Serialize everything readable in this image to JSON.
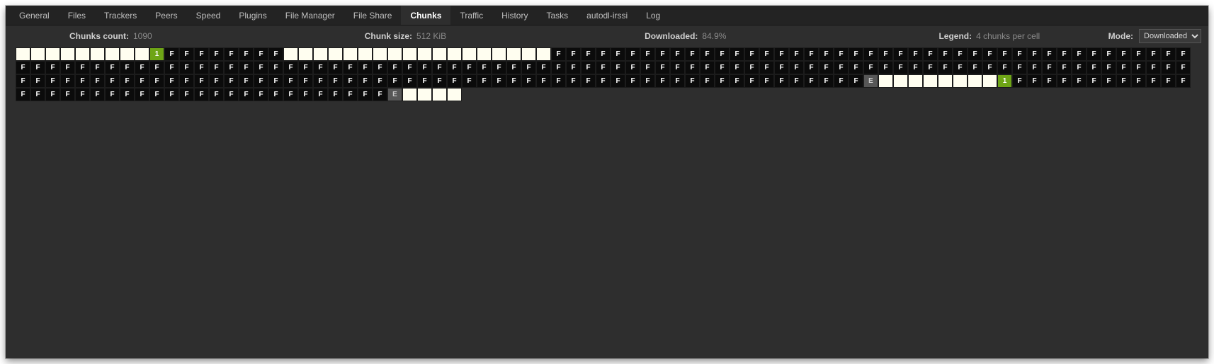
{
  "tabs": [
    {
      "label": "General",
      "active": false
    },
    {
      "label": "Files",
      "active": false
    },
    {
      "label": "Trackers",
      "active": false
    },
    {
      "label": "Peers",
      "active": false
    },
    {
      "label": "Speed",
      "active": false
    },
    {
      "label": "Plugins",
      "active": false
    },
    {
      "label": "File Manager",
      "active": false
    },
    {
      "label": "File Share",
      "active": false
    },
    {
      "label": "Chunks",
      "active": true
    },
    {
      "label": "Traffic",
      "active": false
    },
    {
      "label": "History",
      "active": false
    },
    {
      "label": "Tasks",
      "active": false
    },
    {
      "label": "autodl-irssi",
      "active": false
    },
    {
      "label": "Log",
      "active": false
    }
  ],
  "info": {
    "chunks_count_label": "Chunks count:",
    "chunks_count_value": "1090",
    "chunk_size_label": "Chunk size:",
    "chunk_size_value": "512 KiB",
    "downloaded_label": "Downloaded:",
    "downloaded_value": "84.9%",
    "legend_label": "Legend:",
    "legend_value": "4 chunks per cell",
    "mode_label": "Mode:",
    "mode_value": "Downloaded"
  },
  "grid": {
    "cols": 74,
    "rows": 4,
    "cells": [
      "E",
      "E",
      "E",
      "E",
      "E",
      "E",
      "E",
      "E",
      "E",
      "G",
      "F",
      "F",
      "F",
      "F",
      "F",
      "F",
      "F",
      "F",
      "E",
      "E",
      "E",
      "E",
      "E",
      "E",
      "E",
      "E",
      "E",
      "E",
      "E",
      "E",
      "E",
      "E",
      "E",
      "E",
      "E",
      "E",
      "F",
      "F",
      "F",
      "F",
      "F",
      "F",
      "F",
      "F",
      "F",
      "F",
      "F",
      "F",
      "F",
      "F",
      "F",
      "F",
      "F",
      "F",
      "F",
      "F",
      "F",
      "F",
      "F",
      "F",
      "F",
      "F",
      "F",
      "F",
      "F",
      "F",
      "F",
      "F",
      "F",
      "F",
      "F",
      "F",
      "F",
      "F",
      "F",
      "F",
      "F",
      "F",
      "F",
      "F",
      "F",
      "F",
      "F",
      "F",
      "F",
      "F",
      "F",
      "F",
      "F",
      "F",
      "F",
      "F",
      "F",
      "F",
      "F",
      "F",
      "F",
      "F",
      "F",
      "F",
      "F",
      "F",
      "F",
      "F",
      "F",
      "F",
      "F",
      "F",
      "F",
      "F",
      "F",
      "F",
      "F",
      "F",
      "F",
      "F",
      "F",
      "F",
      "F",
      "F",
      "F",
      "F",
      "F",
      "F",
      "F",
      "F",
      "F",
      "F",
      "F",
      "F",
      "F",
      "F",
      "F",
      "F",
      "F",
      "F",
      "F",
      "F",
      "F",
      "F",
      "F",
      "F",
      "F",
      "F",
      "F",
      "F",
      "F",
      "F",
      "F",
      "F",
      "F",
      "F",
      "F",
      "F",
      "F",
      "F",
      "F",
      "F",
      "F",
      "F",
      "F",
      "F",
      "F",
      "F",
      "F",
      "F",
      "F",
      "F",
      "F",
      "F",
      "F",
      "F",
      "F",
      "F",
      "F",
      "F",
      "F",
      "F",
      "F",
      "F",
      "F",
      "F",
      "F",
      "F",
      "F",
      "F",
      "F",
      "F",
      "F",
      "F",
      "F",
      "F",
      "F",
      "F",
      "F",
      "F",
      "F",
      "F",
      "F",
      "F",
      "F",
      "F",
      "F",
      "F",
      "F",
      "F",
      "F",
      "F",
      "F",
      "F",
      "F",
      "F",
      "F",
      "F",
      "F",
      "P",
      "E",
      "E",
      "E",
      "E",
      "E",
      "E",
      "E",
      "E",
      "G",
      "F",
      "F",
      "F",
      "F",
      "F",
      "F",
      "F",
      "F",
      "F",
      "F",
      "F",
      "F",
      "F",
      "F",
      "F",
      "F",
      "F",
      "F",
      "F",
      "F",
      "F",
      "F",
      "F",
      "F",
      "F",
      "F",
      "F",
      "F",
      "F",
      "F",
      "F",
      "F",
      "F",
      "F",
      "F",
      "F",
      "F",
      "P",
      "E",
      "E",
      "E",
      "E"
    ]
  },
  "letters": {
    "F": "F",
    "G": "1",
    "P": "E",
    "E": ""
  }
}
